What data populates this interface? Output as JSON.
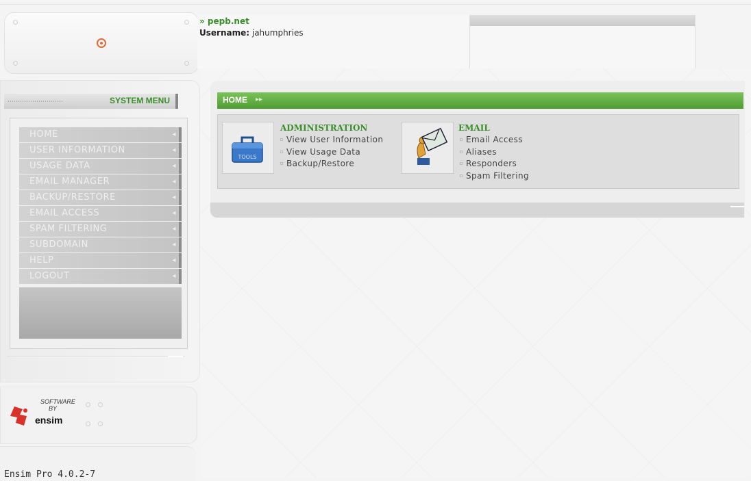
{
  "header": {
    "site_name": "» pepb.net",
    "username_label": "Username:",
    "username": "jahumphries"
  },
  "sidebar": {
    "title": "SYSTEM MENU",
    "items": [
      {
        "label": "HOME"
      },
      {
        "label": "USER INFORMATION"
      },
      {
        "label": "USAGE DATA"
      },
      {
        "label": "EMAIL MANAGER"
      },
      {
        "label": "BACKUP/RESTORE"
      },
      {
        "label": "EMAIL ACCESS"
      },
      {
        "label": "SPAM FILTERING"
      },
      {
        "label": "SUBDOMAIN"
      },
      {
        "label": "HELP"
      },
      {
        "label": "LOGOUT"
      }
    ]
  },
  "branding": {
    "software": "SOFTWARE",
    "by": "BY",
    "name": "ensim",
    "version": "Ensim Pro 4.0.2-7"
  },
  "main": {
    "breadcrumb": "HOME",
    "breadcrumb_arrows": "▸▸",
    "sections": [
      {
        "title": "ADMINISTRATION",
        "icon": "toolbox-icon",
        "links": [
          "View User Information",
          "View Usage Data",
          "Backup/Restore"
        ]
      },
      {
        "title": "EMAIL",
        "icon": "mail-envelope-icon",
        "links": [
          "Email Access",
          "Aliases",
          "Responders",
          "Spam Filtering"
        ]
      }
    ]
  },
  "colors": {
    "accent_green": "#3a8e2a",
    "home_bar": "#5fae3f",
    "menu_item": "#c8c8c8"
  }
}
